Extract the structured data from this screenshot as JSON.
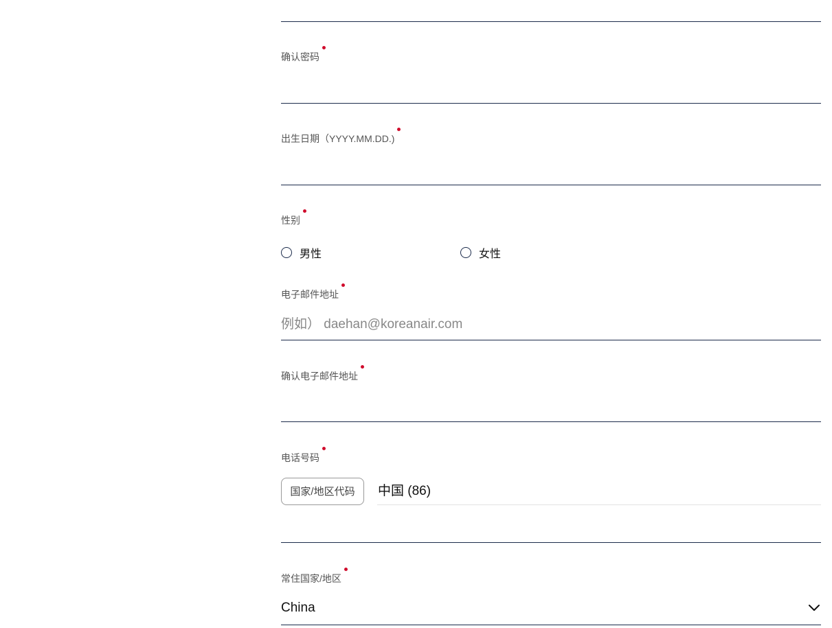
{
  "form": {
    "confirm_password": {
      "label": "确认密码"
    },
    "birth_date": {
      "label": "出生日期（YYYY.MM.DD.)"
    },
    "gender": {
      "label": "性别",
      "options": [
        "男性",
        "女性"
      ]
    },
    "email": {
      "label": "电子邮件地址",
      "placeholder": "例如） daehan@koreanair.com"
    },
    "confirm_email": {
      "label": "确认电子邮件地址"
    },
    "phone": {
      "label": "电话号码",
      "country_code_button": "国家/地区代码",
      "country_code_value": "中国 (86)"
    },
    "residence": {
      "label": "常住国家/地区",
      "value": "China"
    }
  },
  "colors": {
    "required_dot": "#d00c2c",
    "underline": "#1a2a4a"
  }
}
